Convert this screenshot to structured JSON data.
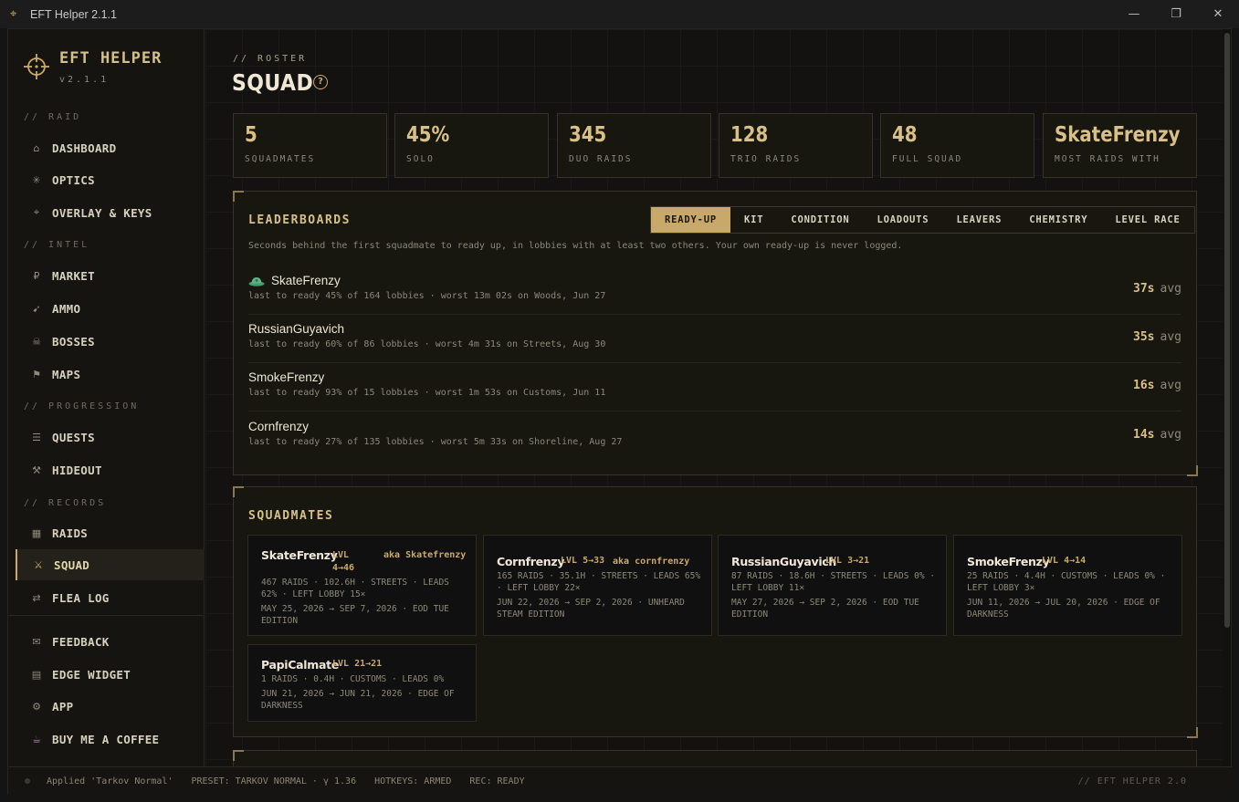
{
  "window": {
    "title": "EFT Helper 2.1.1",
    "minimize": "—",
    "restore": "❐",
    "close": "✕"
  },
  "sidebar": {
    "brand": "EFT HELPER",
    "version": "v2.1.1",
    "sections": {
      "raid": "// RAID",
      "intel": "// INTEL",
      "progression": "// PROGRESSION",
      "records": "// RECORDS"
    },
    "items": [
      {
        "label": "DASHBOARD",
        "icon": "⌂"
      },
      {
        "label": "OPTICS",
        "icon": "✳"
      },
      {
        "label": "OVERLAY & KEYS",
        "icon": "⌖"
      },
      {
        "label": "MARKET",
        "icon": "₽"
      },
      {
        "label": "AMMO",
        "icon": "➹"
      },
      {
        "label": "BOSSES",
        "icon": "☠"
      },
      {
        "label": "MAPS",
        "icon": "⚑"
      },
      {
        "label": "QUESTS",
        "icon": "☰"
      },
      {
        "label": "HIDEOUT",
        "icon": "⚒"
      },
      {
        "label": "RAIDS",
        "icon": "▦"
      },
      {
        "label": "SQUAD",
        "icon": "⚔"
      },
      {
        "label": "FLEA LOG",
        "icon": "⇄"
      },
      {
        "label": "FEEDBACK",
        "icon": "✉"
      },
      {
        "label": "EDGE WIDGET",
        "icon": "▤"
      },
      {
        "label": "APP",
        "icon": "⚙"
      },
      {
        "label": "BUY ME A COFFEE",
        "icon": "☕"
      }
    ]
  },
  "header": {
    "crumb": "// ROSTER",
    "title": "SQUAD",
    "help": "?"
  },
  "stats": [
    {
      "value": "5",
      "label": "SQUADMATES"
    },
    {
      "value": "45%",
      "label": "SOLO"
    },
    {
      "value": "345",
      "label": "DUO RAIDS"
    },
    {
      "value": "128",
      "label": "TRIO RAIDS"
    },
    {
      "value": "48",
      "label": "FULL SQUAD"
    },
    {
      "value": "SkateFrenzy",
      "label": "MOST RAIDS WITH"
    }
  ],
  "leaderboards": {
    "title": "LEADERBOARDS",
    "tabs": [
      "READY-UP",
      "KIT",
      "CONDITION",
      "LOADOUTS",
      "LEAVERS",
      "CHEMISTRY",
      "LEVEL RACE"
    ],
    "active_tab": "READY-UP",
    "description": "Seconds behind the first squadmate to ready up, in lobbies with at least two others. Your own ready-up is never logged.",
    "rows": [
      {
        "name": "SkateFrenzy",
        "sub": "last to ready 45% of 164 lobbies · worst 13m 02s on Woods, Jun 27",
        "value": "37s",
        "unit": "avg",
        "hat": true
      },
      {
        "name": "RussianGuyavich",
        "sub": "last to ready 60% of 86 lobbies · worst 4m 31s on Streets, Aug 30",
        "value": "35s",
        "unit": "avg"
      },
      {
        "name": "SmokeFrenzy",
        "sub": "last to ready 93% of 15 lobbies · worst 1m 53s on Customs, Jun 11",
        "value": "16s",
        "unit": "avg"
      },
      {
        "name": "Cornfrenzy",
        "sub": "last to ready 27% of 135 lobbies · worst 5m 33s on Shoreline, Aug 27",
        "value": "14s",
        "unit": "avg"
      }
    ]
  },
  "squadmates": {
    "title": "SQUADMATES",
    "cards": [
      {
        "name": "SkateFrenzy",
        "lvl": "LVL 4→46",
        "aka": "aka Skatefrenzy",
        "stats": "467 RAIDS · 102.6H · STREETS · LEADS 62% · LEFT LOBBY 15×",
        "dates": "MAY 25, 2026 → SEP 7, 2026 · EOD TUE EDITION"
      },
      {
        "name": "Cornfrenzy",
        "lvl": "LVL 5→33",
        "aka": "aka cornfrenzy",
        "stats": "165 RAIDS · 35.1H · STREETS · LEADS 65% · LEFT LOBBY 22×",
        "dates": "JUN 22, 2026 → SEP 2, 2026 · UNHEARD STEAM EDITION"
      },
      {
        "name": "RussianGuyavich",
        "lvl": "LVL 3→21",
        "aka": "",
        "stats": "87 RAIDS · 18.6H · STREETS · LEADS 0% · LEFT LOBBY 11×",
        "dates": "MAY 27, 2026 → SEP 2, 2026 · EOD TUE EDITION"
      },
      {
        "name": "SmokeFrenzy",
        "lvl": "LVL 4→14",
        "aka": "",
        "stats": "25 RAIDS · 4.4H · CUSTOMS · LEADS 0% · LEFT LOBBY 3×",
        "dates": "JUN 11, 2026 → JUL 20, 2026 · EDGE OF DARKNESS"
      },
      {
        "name": "PapiCalmate",
        "lvl": "LVL 21→21",
        "aka": "",
        "stats": "1 RAIDS · 0.4H · CUSTOMS · LEADS 0%",
        "dates": "JUN 21, 2026 → JUN 21, 2026 · EDGE OF DARKNESS"
      }
    ]
  },
  "status": {
    "applied": "Applied 'Tarkov Normal'",
    "preset": "PRESET: TARKOV NORMAL · γ 1.36",
    "hotkeys": "HOTKEYS: ARMED",
    "rec": "REC: READY",
    "right": "// EFT HELPER 2.0"
  },
  "colors": {
    "accent": "#c8a96a",
    "bg": "#121110",
    "panel": "#17160f"
  }
}
